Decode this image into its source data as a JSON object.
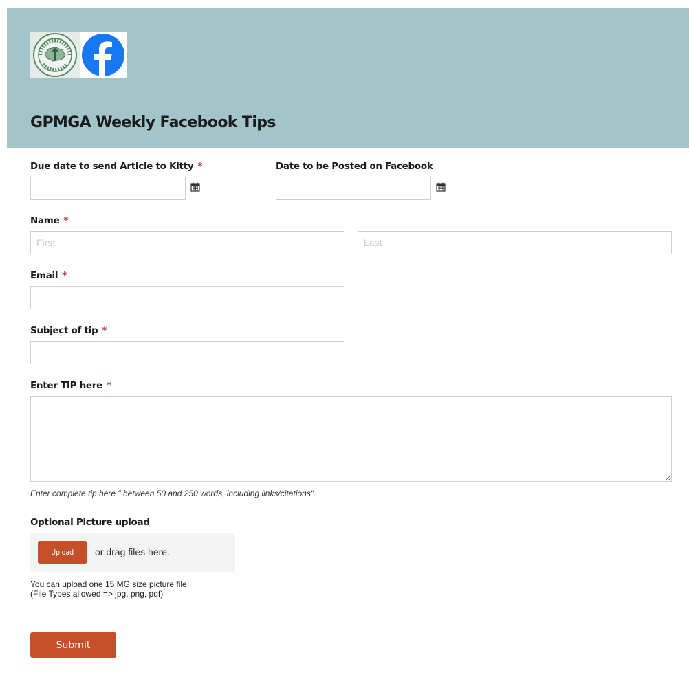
{
  "header": {
    "background_color": "#a3c5c9",
    "title": "GPMGA Weekly Facebook Tips",
    "seal_icon": "master-gardener-seal",
    "facebook_icon": "facebook-logo"
  },
  "fields": {
    "due_date": {
      "label": "Due date to send Article to Kitty",
      "required_mark": "*",
      "value": ""
    },
    "post_date": {
      "label": "Date to be Posted on Facebook",
      "value": ""
    },
    "name": {
      "label": "Name",
      "required_mark": "*",
      "first_placeholder": "First",
      "last_placeholder": "Last"
    },
    "email": {
      "label": "Email",
      "required_mark": "*",
      "value": ""
    },
    "subject": {
      "label": "Subject of tip",
      "required_mark": "*",
      "value": ""
    },
    "tip": {
      "label": "Enter TIP here",
      "required_mark": "*",
      "value": "",
      "help": "Enter complete tip here \" between 50 and 250 words, including links/citations\"."
    },
    "picture": {
      "label": "Optional Picture upload",
      "upload_label": "Upload",
      "drag_text": "or drag files here.",
      "note_line1": "You can upload one 15 MG size picture file.",
      "note_line2": "(File Types allowed => jpg, png, pdf)"
    }
  },
  "submit": {
    "label": "Submit"
  },
  "colors": {
    "accent": "#c4502a",
    "required": "#b0413e",
    "facebook_blue": "#1877f2"
  }
}
